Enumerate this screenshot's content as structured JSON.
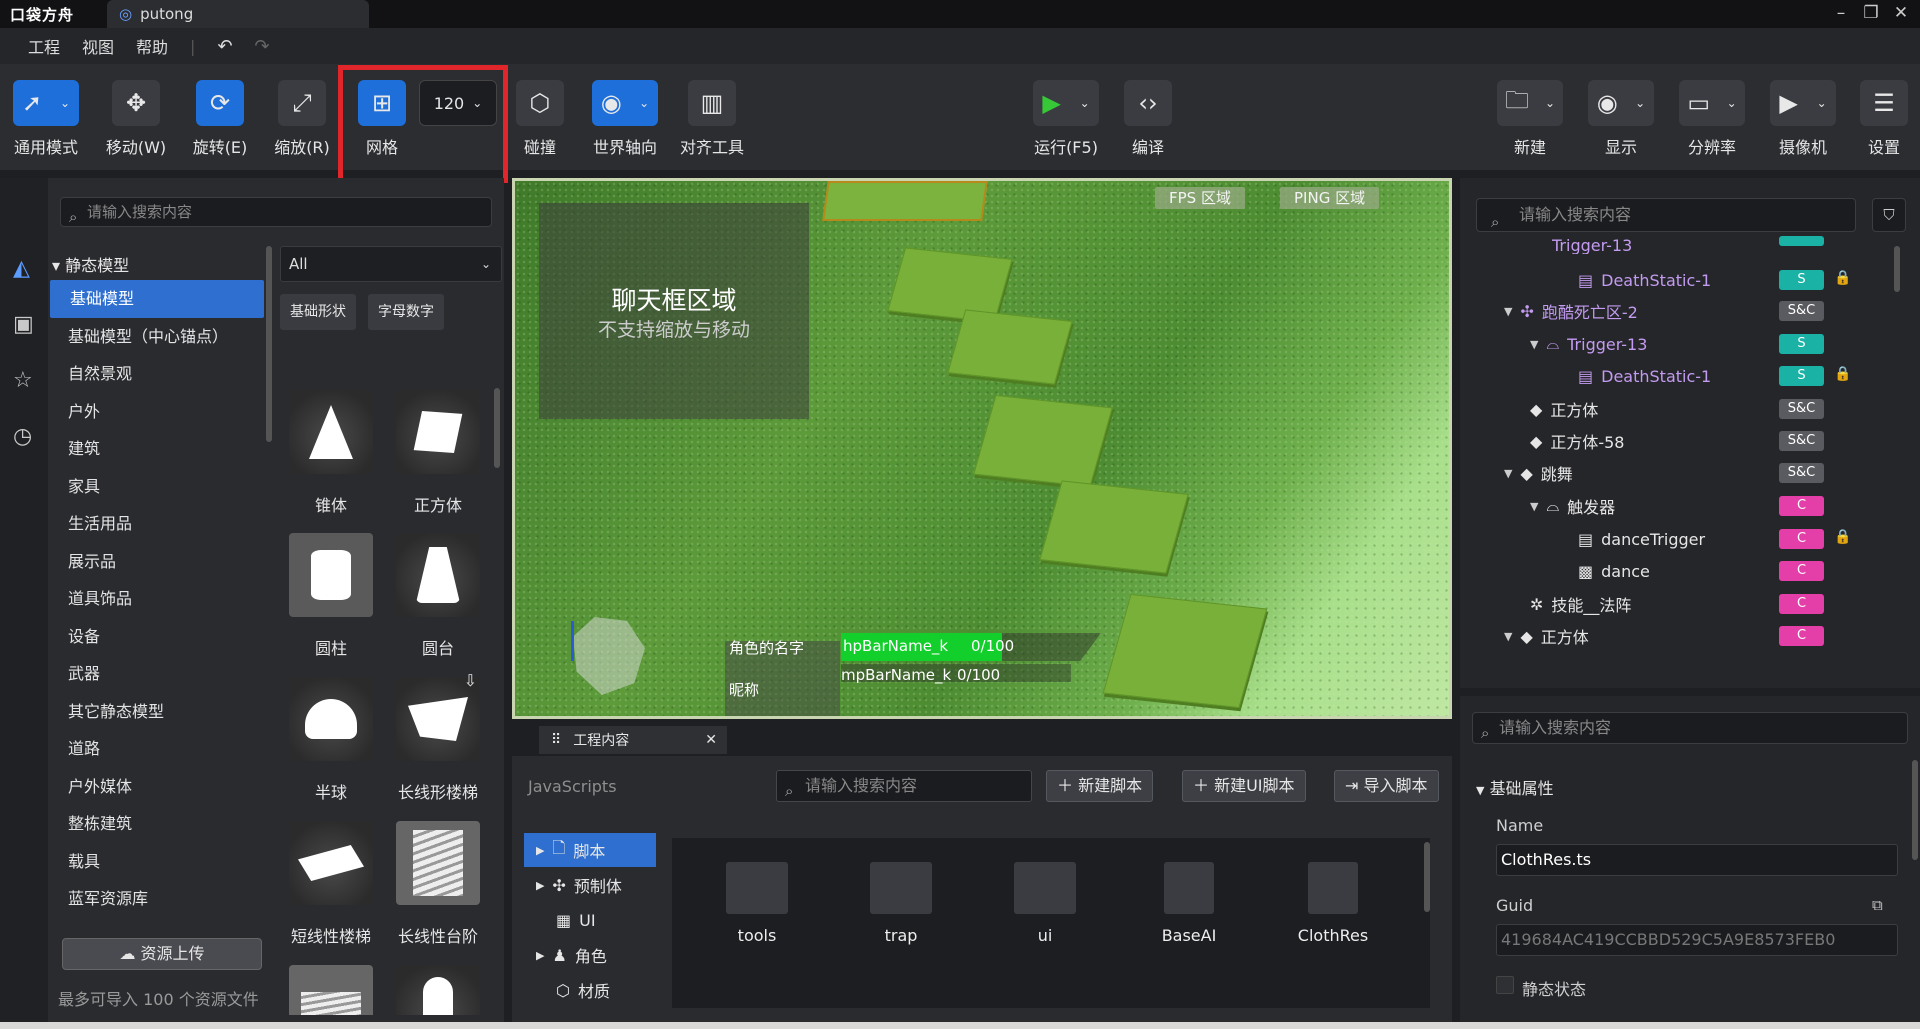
{
  "app": {
    "logo": "口袋方舟",
    "tab_title": "putong"
  },
  "menu": {
    "items": [
      "工程",
      "视图",
      "帮助"
    ]
  },
  "toolbar": {
    "mode_label": "通用模式",
    "move_label": "移动(W)",
    "rotate_label": "旋转(E)",
    "scale_label": "缩放(R)",
    "grid_label": "网格",
    "grid_value": "120",
    "collision_label": "碰撞",
    "world_axis_label": "世界轴向",
    "align_label": "对齐工具",
    "run_label": "运行(F5)",
    "compile_label": "编译",
    "new_label": "新建",
    "display_label": "显示",
    "resolution_label": "分辨率",
    "camera_label": "摄像机",
    "settings_label": "设置"
  },
  "asset_panel": {
    "search_placeholder": "请输入搜索内容",
    "header": "静态模型",
    "categories": [
      "基础模型",
      "基础模型（中心锚点）",
      "自然景观",
      "户外",
      "建筑",
      "家具",
      "生活用品",
      "展示品",
      "道具饰品",
      "设备",
      "武器",
      "其它静态模型",
      "道路",
      "户外媒体",
      "整栋建筑",
      "载具",
      "蓝军资源库"
    ],
    "selected_category": "基础模型",
    "filter_value": "All",
    "chips": [
      "基础形状",
      "字母数字"
    ],
    "assets": [
      "锥体",
      "正方体",
      "圆柱",
      "圆台",
      "半球",
      "长线形楼梯",
      "短线性楼梯",
      "长线性台阶"
    ],
    "upload_label": "资源上传",
    "upload_note": "最多可导入 100 个资源文件"
  },
  "viewport": {
    "chat_title": "聊天框区域",
    "chat_subtitle": "不支持缩放与移动",
    "fps_zone": "FPS 区域",
    "ping_zone": "PING 区域",
    "char_name": "角色的名字",
    "nickname": "昵称",
    "hp_bar_name": "hpBarName_k",
    "hp_value": "0/100",
    "mp_bar_name": "mpBarName_k",
    "mp_value": "0/100",
    "hp_fill": 0.62
  },
  "project": {
    "tab_title": "工程内容",
    "lang_label": "JavaScripts",
    "search_placeholder": "请输入搜索内容",
    "new_script": "新建脚本",
    "new_ui_script": "新建UI脚本",
    "import_script": "导入脚本",
    "tree": [
      "脚本",
      "预制体",
      "UI",
      "角色",
      "材质"
    ],
    "folders": [
      "tools",
      "trap",
      "ui",
      "BaseAI",
      "ClothRes"
    ]
  },
  "hierarchy": {
    "search_placeholder": "请输入搜索内容",
    "rows": [
      {
        "label": "Trigger-13",
        "badge": "S"
      },
      {
        "label": "DeathStatic-1",
        "badge": "S"
      },
      {
        "label": "跑酷死亡区-2",
        "badge": "S&C"
      },
      {
        "label": "Trigger-13",
        "badge": "S"
      },
      {
        "label": "DeathStatic-1",
        "badge": "S"
      },
      {
        "label": "正方体",
        "badge": "S&C"
      },
      {
        "label": "正方体-58",
        "badge": "S&C"
      },
      {
        "label": "跳舞",
        "badge": "S&C"
      },
      {
        "label": "触发器",
        "badge": "C"
      },
      {
        "label": "danceTrigger",
        "badge": "C"
      },
      {
        "label": "dance",
        "badge": "C"
      },
      {
        "label": "技能__法阵",
        "badge": "C"
      },
      {
        "label": "正方体",
        "badge": "C"
      }
    ]
  },
  "inspector": {
    "search_placeholder": "请输入搜索内容",
    "section": "基础属性",
    "name_label": "Name",
    "name_value": "ClothRes.ts",
    "guid_label": "Guid",
    "guid_value": "419684AC419CCBBD529C5A9E8573FEB0",
    "static_label": "静态状态"
  },
  "colors": {
    "accent": "#2f6fcf",
    "highlight": "#e0262a",
    "badge_s": "#19b2a4",
    "badge_c": "#e43fa8",
    "badge_sc": "#5a5b60"
  }
}
